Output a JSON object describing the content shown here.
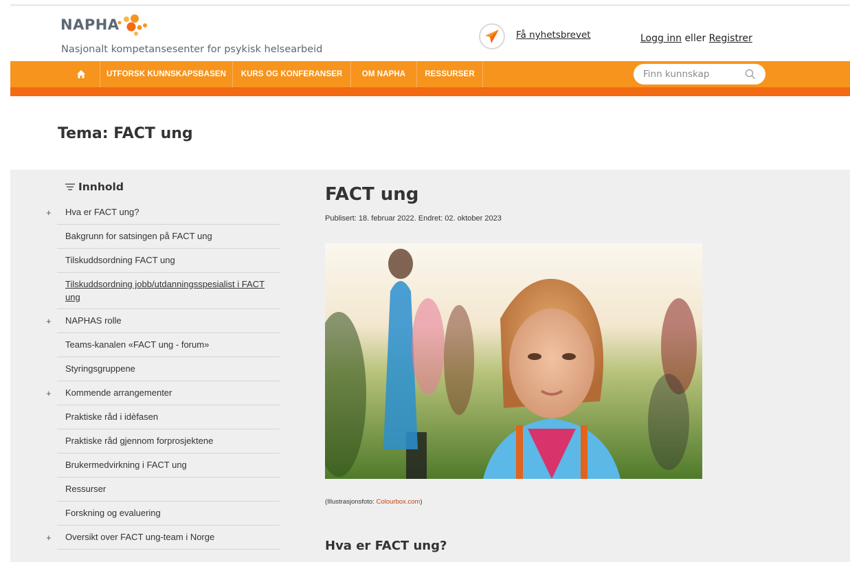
{
  "header": {
    "logo_text": "NAPHA",
    "tagline": "Nasjonalt kompetansesenter for psykisk helsearbeid",
    "newsletter_label": "Få nyhetsbrevet",
    "login_label": "Logg inn",
    "login_sep": "eller",
    "register_label": "Registrer"
  },
  "nav": {
    "items": [
      "UTFORSK KUNNSKAPSBASEN",
      "KURS OG KONFERANSER",
      "OM NAPHA",
      "RESSURSER"
    ],
    "search_placeholder": "Finn kunnskap"
  },
  "page": {
    "title": "Tema: FACT ung"
  },
  "sidebar": {
    "heading": "Innhold",
    "items": [
      {
        "label": "Hva er FACT ung?",
        "expandable": "+"
      },
      {
        "label": "Bakgrunn for satsingen på FACT ung"
      },
      {
        "label": "Tilskuddsordning FACT ung"
      },
      {
        "label": "Tilskuddsordning jobb/utdanningsspesialist i FACT ung"
      },
      {
        "label": "NAPHAS rolle",
        "expandable": "+"
      },
      {
        "label": "Teams-kanalen «FACT ung - forum»"
      },
      {
        "label": "Styringsgruppene"
      },
      {
        "label": "Kommende arrangementer",
        "expandable": "+"
      },
      {
        "label": "Praktiske råd i idèfasen"
      },
      {
        "label": "Praktiske råd gjennom forprosjektene"
      },
      {
        "label": "Brukermedvirkning i FACT ung"
      },
      {
        "label": "Ressurser"
      },
      {
        "label": "Forskning og evaluering"
      },
      {
        "label": "Oversikt over FACT ung-team i Norge",
        "expandable": "+"
      }
    ]
  },
  "article": {
    "title": "FACT ung",
    "meta": "Publisert: 18. februar 2022.   Endret: 02. oktober 2023",
    "caption_prefix": "(Illustrasjonsfoto: ",
    "caption_source": "Colourbox.com",
    "caption_suffix": ")",
    "section_heading": "Hva er FACT ung?"
  },
  "colors": {
    "nav_orange": "#f7941d",
    "nav_underline": "#f26a12",
    "content_bg": "#efefef",
    "caption_link": "#c1440e"
  }
}
